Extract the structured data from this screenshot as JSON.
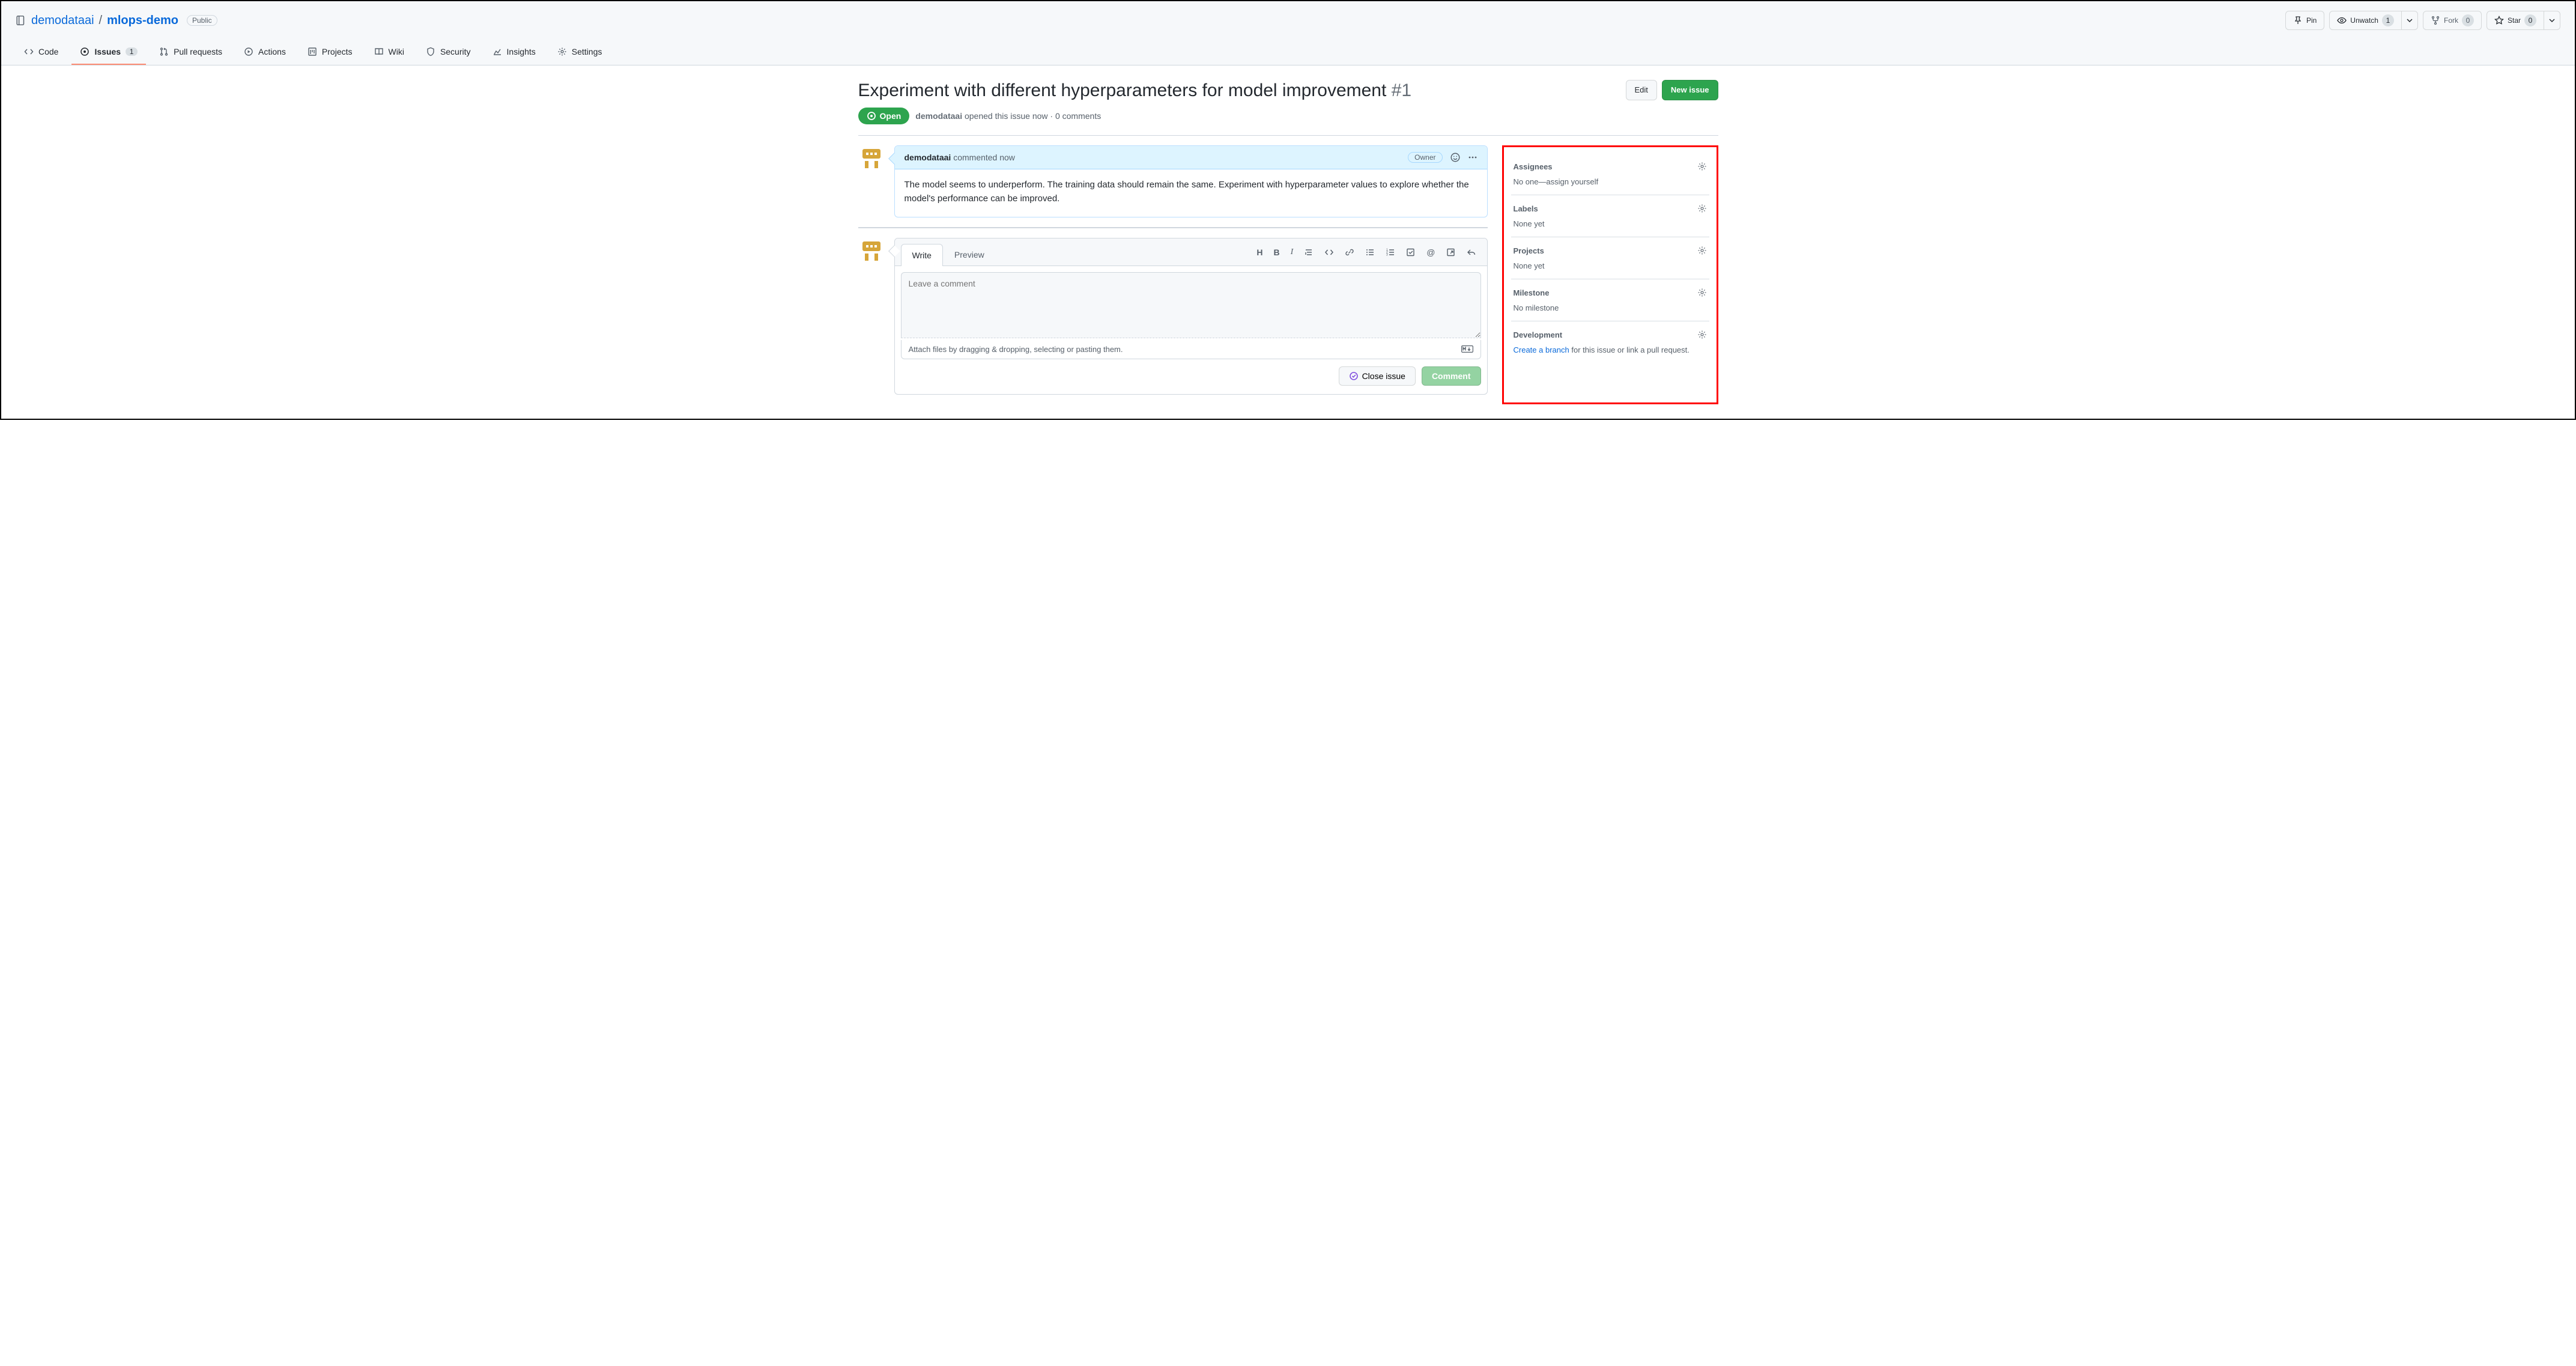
{
  "repo": {
    "owner": "demodataai",
    "name": "mlops-demo",
    "visibility": "Public"
  },
  "repo_actions": {
    "pin": "Pin",
    "unwatch": "Unwatch",
    "unwatch_count": "1",
    "fork": "Fork",
    "fork_count": "0",
    "star": "Star",
    "star_count": "0"
  },
  "nav": {
    "code": "Code",
    "issues": "Issues",
    "issues_count": "1",
    "pulls": "Pull requests",
    "actions": "Actions",
    "projects": "Projects",
    "wiki": "Wiki",
    "security": "Security",
    "insights": "Insights",
    "settings": "Settings"
  },
  "issue": {
    "title": "Experiment with different hyperparameters for model improvement",
    "number": "#1",
    "state": "Open",
    "author": "demodataai",
    "opened_text": "opened this issue now · 0 comments",
    "edit": "Edit",
    "new_issue": "New issue"
  },
  "comment": {
    "author": "demodataai",
    "time_text": "commented now",
    "owner_badge": "Owner",
    "body": "The model seems to underperform. The training data should remain the same. Experiment with hyperparameter values to explore whether the model's performance can be improved."
  },
  "composer": {
    "write_tab": "Write",
    "preview_tab": "Preview",
    "placeholder": "Leave a comment",
    "attach_hint": "Attach files by dragging & dropping, selecting or pasting them.",
    "close_issue": "Close issue",
    "comment_btn": "Comment"
  },
  "sidebar": {
    "assignees": {
      "title": "Assignees",
      "body_prefix": "No one—",
      "assign_self": "assign yourself"
    },
    "labels": {
      "title": "Labels",
      "body": "None yet"
    },
    "projects": {
      "title": "Projects",
      "body": "None yet"
    },
    "milestone": {
      "title": "Milestone",
      "body": "No milestone"
    },
    "development": {
      "title": "Development",
      "link": "Create a branch",
      "rest": " for this issue or link a pull request."
    }
  }
}
